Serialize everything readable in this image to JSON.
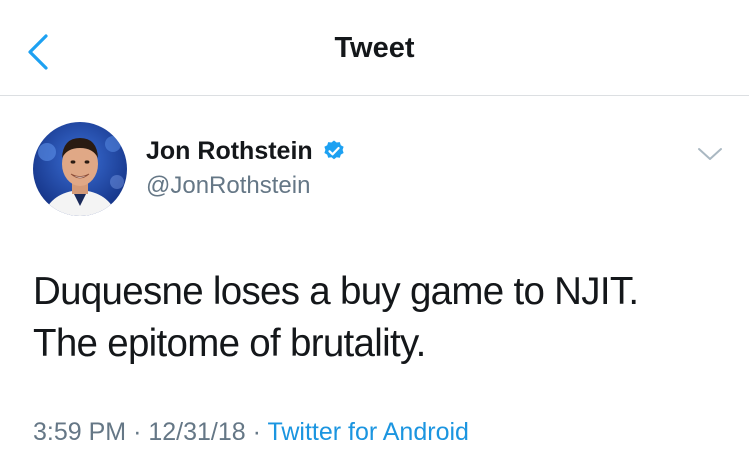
{
  "nav": {
    "title": "Tweet"
  },
  "tweet": {
    "display_name": "Jon Rothstein",
    "handle": "@JonRothstein",
    "verified": true,
    "text_lines": [
      "Duquesne loses a buy game to NJIT.",
      "The epitome of brutality."
    ],
    "time": "3:59 PM",
    "date": "12/31/18",
    "separator": "·",
    "source": "Twitter for Android"
  },
  "icons": {
    "back": "chevron-left-icon",
    "verified": "verified-badge-icon",
    "caret": "chevron-down-icon"
  },
  "colors": {
    "accent": "#1da1f2",
    "secondary_text": "#657786",
    "primary_text": "#14171a",
    "source_link": "#1b95e0"
  }
}
